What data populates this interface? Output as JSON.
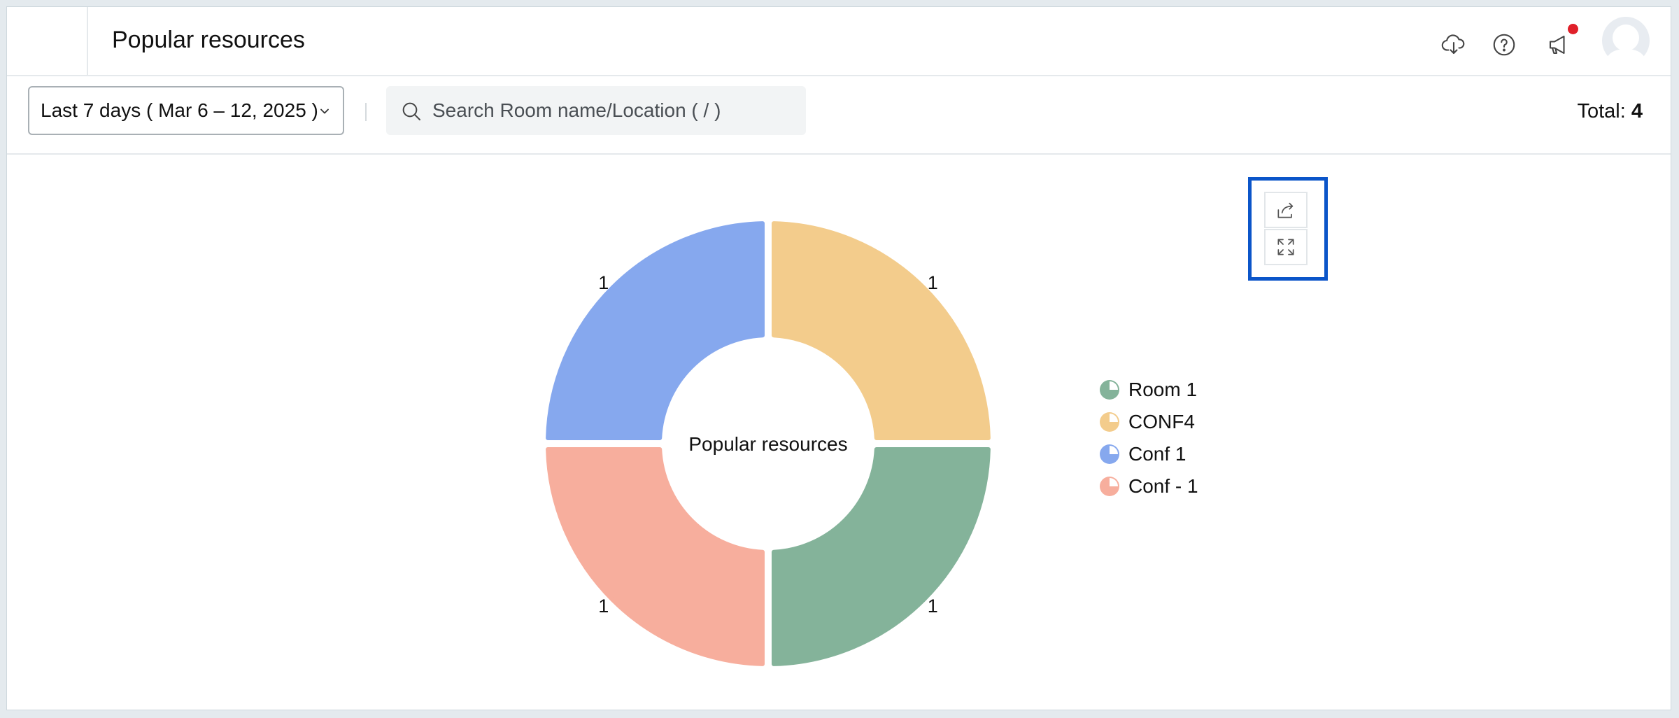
{
  "header": {
    "title": "Popular resources",
    "icons": [
      "download-cloud-icon",
      "help-icon",
      "announcement-icon",
      "avatar"
    ]
  },
  "filters": {
    "date_range": "Last 7 days ( Mar 6 – 12, 2025 )",
    "search_placeholder": "Search Room name/Location ( / )",
    "total_label": "Total:",
    "total_value": "4"
  },
  "chart_tools": [
    "share-icon",
    "expand-icon"
  ],
  "chart_data": {
    "type": "pie",
    "title": "Popular resources",
    "slices": [
      {
        "label": "Room 1",
        "value": 1,
        "color": "#84b39a"
      },
      {
        "label": "CONF4",
        "value": 1,
        "color": "#f3cc8c"
      },
      {
        "label": "Conf 1",
        "value": 1,
        "color": "#86a8ee"
      },
      {
        "label": "Conf - 1",
        "value": 1,
        "color": "#f7ae9d"
      }
    ],
    "legend": "right",
    "inner_label": "Popular resources"
  },
  "colors": {
    "accent": "#0b55c9",
    "notification": "#e0202a"
  }
}
